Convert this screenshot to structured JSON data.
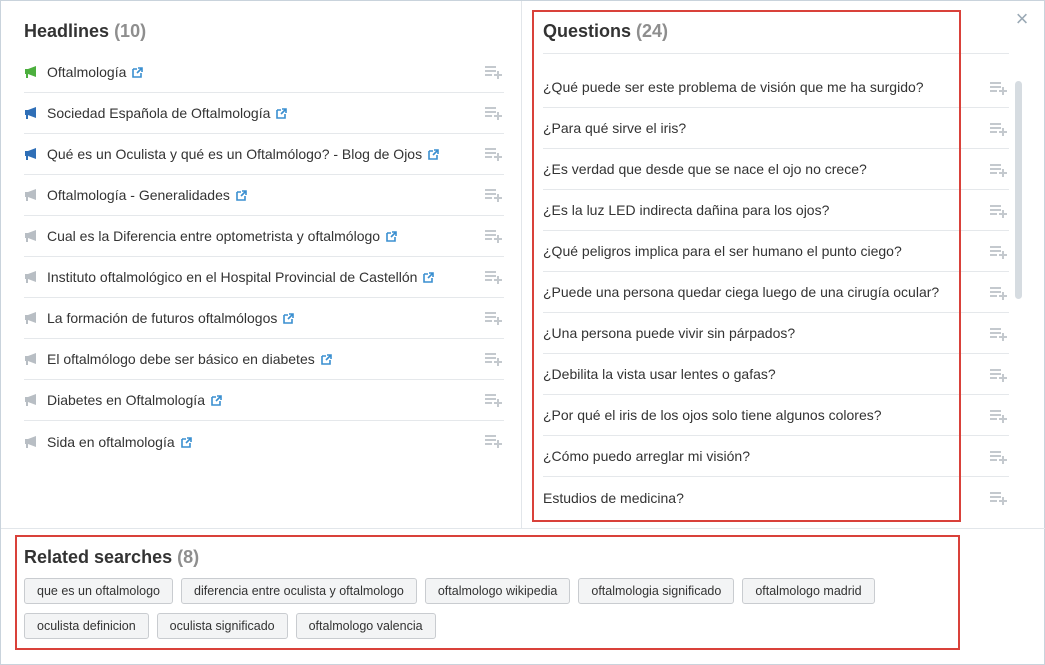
{
  "colors": {
    "accent_border": "#d9413a",
    "link_icon": "#3a8fd0",
    "green_icon": "#4caf3e",
    "blue_icon": "#2f6fb7",
    "gray_icon": "#b8bec4"
  },
  "headlines": {
    "title": "Headlines",
    "count": "(10)",
    "items": [
      {
        "text": "Oftalmología",
        "icon": "green-megaphone-icon"
      },
      {
        "text": "Sociedad Española de Oftalmología",
        "icon": "blue-megaphone-icon"
      },
      {
        "text": "Qué es un Oculista y qué es un Oftalmólogo? - Blog de Ojos",
        "icon": "blue-megaphone-icon"
      },
      {
        "text": "Oftalmología - Generalidades",
        "icon": "gray-megaphone-icon"
      },
      {
        "text": "Cual es la Diferencia entre optometrista y oftalmólogo",
        "icon": "gray-megaphone-icon"
      },
      {
        "text": "Instituto oftalmológico en el Hospital Provincial de Castellón",
        "icon": "gray-megaphone-icon"
      },
      {
        "text": "La formación de futuros oftalmólogos",
        "icon": "gray-megaphone-icon"
      },
      {
        "text": "El oftalmólogo debe ser básico en diabetes",
        "icon": "gray-megaphone-icon"
      },
      {
        "text": "Diabetes en Oftalmología",
        "icon": "gray-megaphone-icon"
      },
      {
        "text": "Sida en oftalmología",
        "icon": "gray-megaphone-icon"
      }
    ]
  },
  "questions": {
    "title": "Questions",
    "count": "(24)",
    "items": [
      "¿Qué puede ser este problema de visión que me ha surgido?",
      "¿Para qué sirve el iris?",
      "¿Es verdad que desde que se nace el ojo no crece?",
      "¿Es la luz LED indirecta dañina para los ojos?",
      "¿Qué peligros implica para el ser humano el punto ciego?",
      "¿Puede una persona quedar ciega luego de una cirugía ocular?",
      "¿Una persona puede vivir sin párpados?",
      "¿Debilita la vista usar lentes o gafas?",
      "¿Por qué el iris de los ojos solo tiene algunos colores?",
      "¿Cómo puedo arreglar mi visión?",
      "Estudios de medicina?"
    ]
  },
  "related": {
    "title": "Related searches",
    "count": "(8)",
    "row1": [
      "que es un oftalmologo",
      "diferencia entre oculista y oftalmologo",
      "oftalmologo wikipedia",
      "oftalmologia significado",
      "oftalmologo madrid"
    ],
    "row2": [
      "oculista definicion",
      "oculista significado",
      "oftalmologo valencia"
    ]
  },
  "close_label": "×"
}
